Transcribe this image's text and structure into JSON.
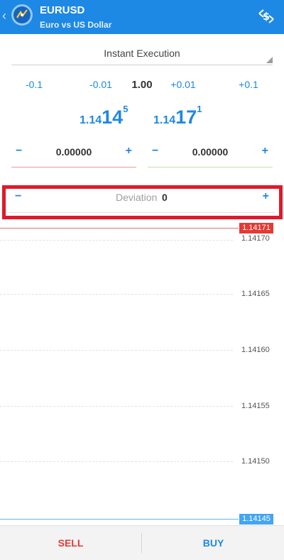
{
  "header": {
    "symbol": "EURUSD",
    "description": "Euro vs US Dollar",
    "back_icon": "chevron-left-icon",
    "logo_icon": "app-logo-icon",
    "trade_icon": "currency-exchange-icon"
  },
  "execution": {
    "mode": "Instant Execution"
  },
  "volume": {
    "minus_01": "-0.1",
    "minus_001": "-0.01",
    "value": "1.00",
    "plus_001": "+0.01",
    "plus_01": "+0.1"
  },
  "prices": {
    "bid": {
      "prefix": "1.14",
      "big": "14",
      "sup": "5"
    },
    "ask": {
      "prefix": "1.14",
      "big": "17",
      "sup": "1"
    }
  },
  "stop_loss": {
    "minus": "−",
    "value": "0.00000",
    "plus": "+"
  },
  "take_profit": {
    "minus": "−",
    "value": "0.00000",
    "plus": "+"
  },
  "deviation": {
    "minus": "−",
    "label": "Deviation",
    "value": "0",
    "plus": "+"
  },
  "chart": {
    "levels": [
      "1.14170",
      "1.14165",
      "1.14160",
      "1.14155",
      "1.14150"
    ],
    "ask_tag": "1.14171",
    "bid_tag": "1.14145",
    "colors": {
      "ask": "#e53935",
      "bid": "#42a5f5"
    }
  },
  "actions": {
    "sell": "SELL",
    "buy": "BUY"
  },
  "colors": {
    "accent": "#1e88e5",
    "header": "#1e88e5",
    "highlight_frame": "#e0192a"
  }
}
